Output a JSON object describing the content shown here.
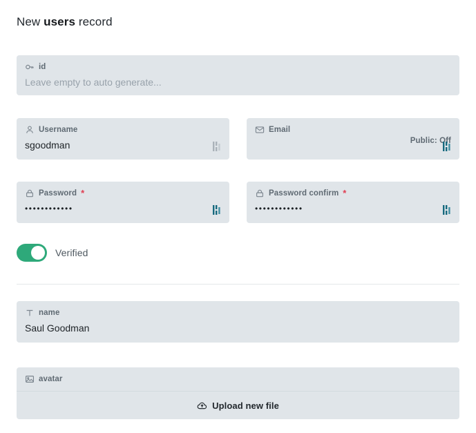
{
  "header": {
    "title_prefix": "New",
    "title_collection": "users",
    "title_suffix": "record"
  },
  "colors": {
    "field_bg": "#e0e5e9",
    "toggle_on": "#2ea97a",
    "required_asterisk": "#e03e52",
    "accent_icon": "#16697e",
    "muted_icon": "#aab2b9",
    "divider": "#e3e7ea"
  },
  "fields": {
    "id": {
      "icon": "key-icon",
      "label": "id",
      "value": "",
      "placeholder": "Leave empty to auto generate...",
      "required": false
    },
    "username": {
      "icon": "user-icon",
      "label": "Username",
      "value": "sgoodman",
      "required": false,
      "trailing_icon": "presentable-toggle-icon",
      "trailing_icon_active": false
    },
    "email": {
      "icon": "envelope-icon",
      "label": "Email",
      "value": "",
      "required": false,
      "public_flag": "Public: Off",
      "trailing_icon": "presentable-toggle-icon",
      "trailing_icon_active": true
    },
    "password": {
      "icon": "lock-icon",
      "label": "Password",
      "required": true,
      "required_marker": "*",
      "value": "••••••••••••",
      "trailing_icon": "presentable-toggle-icon",
      "trailing_icon_active": true
    },
    "password_confirm": {
      "icon": "lock-icon",
      "label": "Password confirm",
      "required": true,
      "required_marker": "*",
      "value": "••••••••••••",
      "trailing_icon": "presentable-toggle-icon",
      "trailing_icon_active": true
    },
    "verified": {
      "label": "Verified",
      "checked": true
    },
    "name": {
      "icon": "text-icon",
      "label": "name",
      "value": "Saul Goodman",
      "required": false
    },
    "avatar": {
      "icon": "image-icon",
      "label": "avatar",
      "upload_label": "Upload new file",
      "upload_icon": "cloud-upload-icon"
    }
  }
}
